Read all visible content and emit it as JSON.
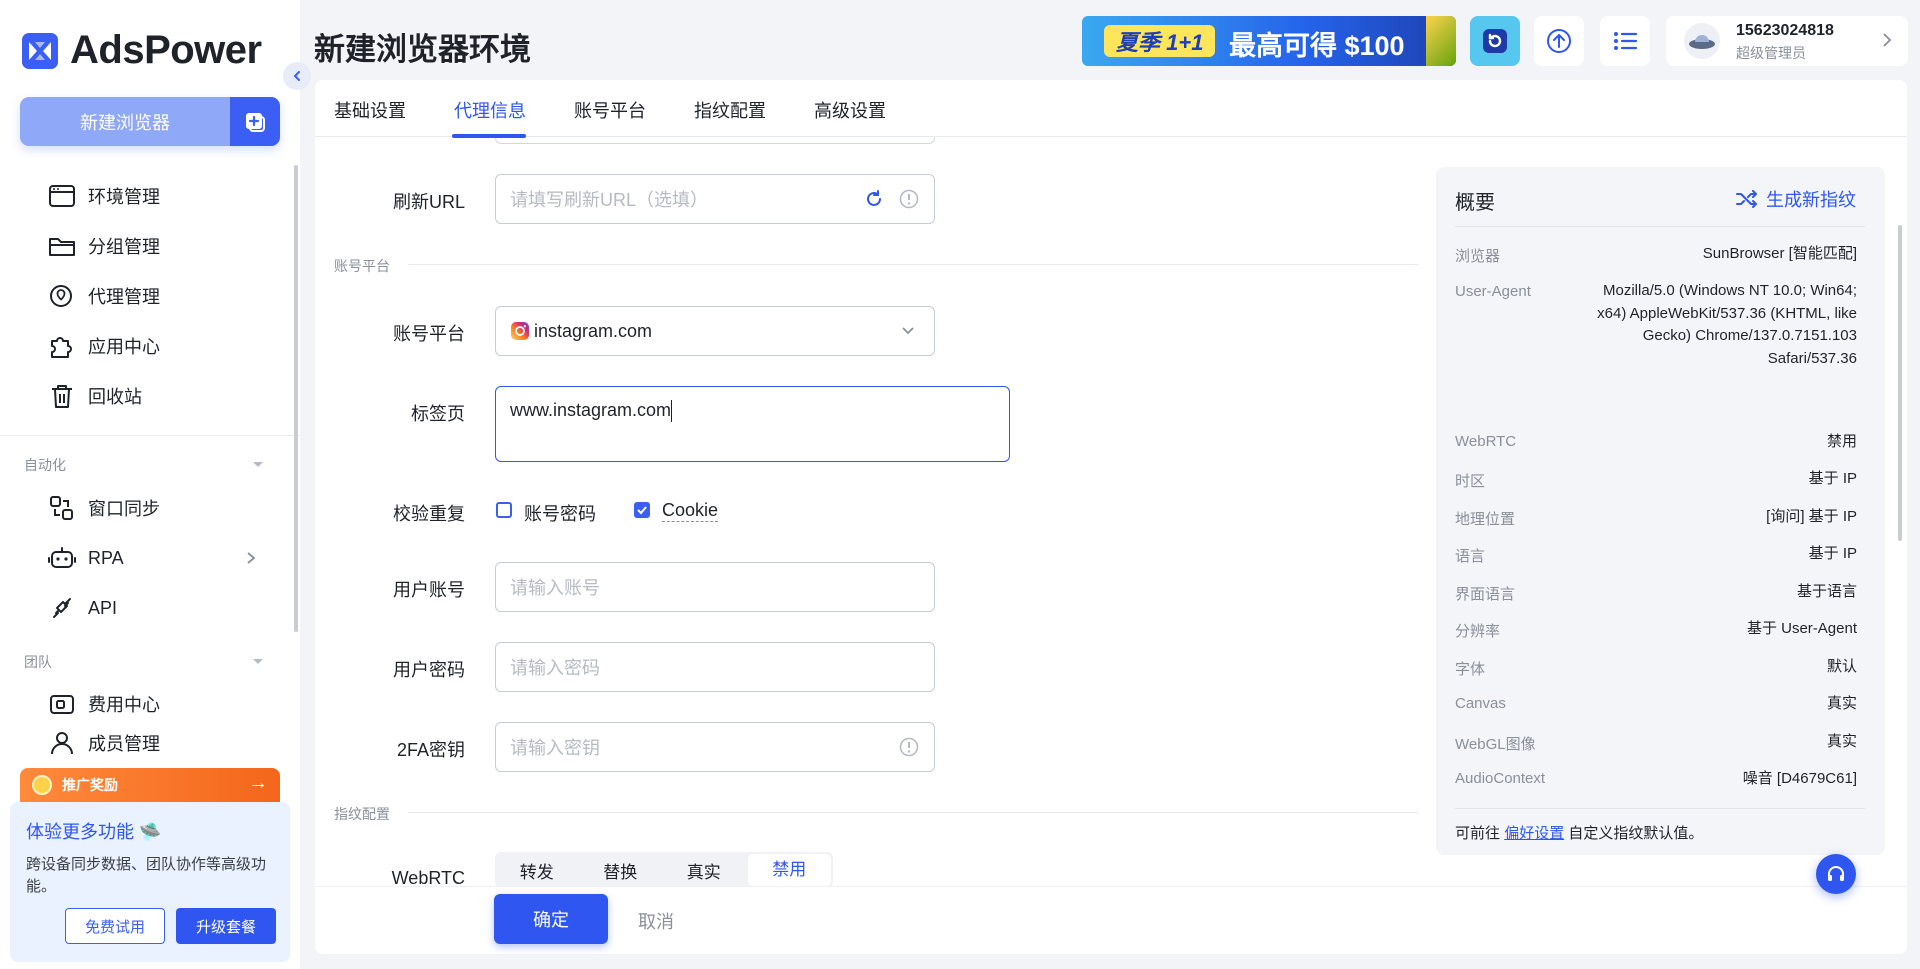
{
  "app": {
    "name": "AdsPower"
  },
  "sidebar": {
    "new_browser": "新建浏览器",
    "items": [
      {
        "label": "环境管理",
        "icon": "browser-window-icon"
      },
      {
        "label": "分组管理",
        "icon": "folder-icon"
      },
      {
        "label": "代理管理",
        "icon": "location-pin-icon"
      },
      {
        "label": "应用中心",
        "icon": "puzzle-icon"
      },
      {
        "label": "回收站",
        "icon": "trash-icon"
      }
    ],
    "section_automation": "自动化",
    "automation_items": [
      {
        "label": "窗口同步",
        "icon": "sync-windows-icon"
      },
      {
        "label": "RPA",
        "icon": "robot-icon"
      },
      {
        "label": "API",
        "icon": "api-plug-icon"
      }
    ],
    "section_team": "团队",
    "team_items": [
      {
        "label": "费用中心",
        "icon": "wallet-icon"
      },
      {
        "label": "成员管理",
        "icon": "members-icon"
      }
    ],
    "promo": {
      "bar": "推广奖励",
      "title": "体验更多功能",
      "desc": "跨设备同步数据、团队协作等高级功能。",
      "trial": "免费试用",
      "upgrade": "升级套餐"
    }
  },
  "header": {
    "title": "新建浏览器环境",
    "banner_tag": "夏季 1+1",
    "banner_text": "最高可得 $100",
    "user_phone": "15623024818",
    "user_role": "超级管理员"
  },
  "tabs": [
    "基础设置",
    "代理信息",
    "账号平台",
    "指纹配置",
    "高级设置"
  ],
  "active_tab": "代理信息",
  "form": {
    "refresh_url_label": "刷新URL",
    "refresh_url_placeholder": "请填写刷新URL（选填）",
    "group_account": "账号平台",
    "platform_label": "账号平台",
    "platform_value": "instagram.com",
    "tab_label": "标签页",
    "tab_value": "www.instagram.com",
    "dedupe_label": "校验重复",
    "dedupe_account": "账号密码",
    "dedupe_cookie": "Cookie",
    "user_account_label": "用户账号",
    "user_account_placeholder": "请输入账号",
    "user_password_label": "用户密码",
    "user_password_placeholder": "请输入密码",
    "twofa_label": "2FA密钥",
    "twofa_placeholder": "请输入密钥",
    "group_fingerprint": "指纹配置",
    "webrtc_label": "WebRTC",
    "webrtc_options": [
      "转发",
      "替换",
      "真实",
      "禁用"
    ],
    "webrtc_selected": "禁用",
    "ok": "确定",
    "cancel": "取消"
  },
  "summary": {
    "title": "概要",
    "generate": "生成新指纹",
    "rows": [
      {
        "k": "浏览器",
        "v": "SunBrowser [智能匹配]"
      },
      {
        "k": "User-Agent",
        "v": "Mozilla/5.0 (Windows NT 10.0; Win64; x64) AppleWebKit/537.36 (KHTML, like Gecko) Chrome/137.0.7151.103 Safari/537.36"
      },
      {
        "k": "WebRTC",
        "v": "禁用"
      },
      {
        "k": "时区",
        "v": "基于 IP"
      },
      {
        "k": "地理位置",
        "v": "[询问] 基于 IP"
      },
      {
        "k": "语言",
        "v": "基于 IP"
      },
      {
        "k": "界面语言",
        "v": "基于语言"
      },
      {
        "k": "分辨率",
        "v": "基于 User-Agent"
      },
      {
        "k": "字体",
        "v": "默认"
      },
      {
        "k": "Canvas",
        "v": "真实"
      },
      {
        "k": "WebGL图像",
        "v": "真实"
      },
      {
        "k": "AudioContext",
        "v": "噪音 [D4679C61]"
      }
    ],
    "footer_pre": "可前往",
    "footer_link": "偏好设置",
    "footer_post": "自定义指纹默认值。"
  },
  "colors": {
    "accent": "#2f56f0",
    "promo": "#f4661b"
  }
}
